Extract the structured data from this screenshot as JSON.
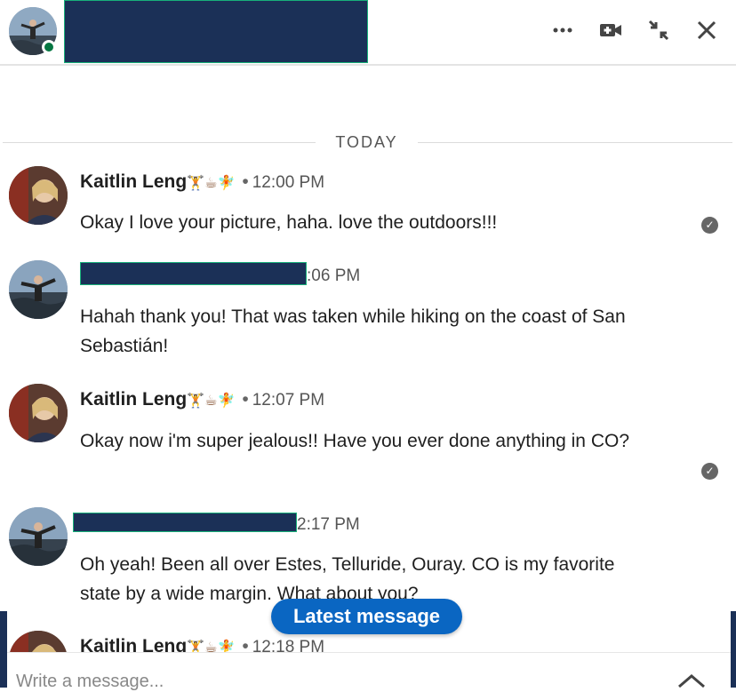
{
  "header": {
    "more_icon": "more-horizontal-icon",
    "video_icon": "video-call-icon",
    "minimize_icon": "minimize-icon",
    "close_icon": "close-icon"
  },
  "divider": {
    "label": "TODAY"
  },
  "messages": [
    {
      "sender": "Kaitlin Leng",
      "emoji": "🏋☕🧚",
      "time": "12:00 PM",
      "text": "Okay I love your picture, haha. love the outdoors!!!",
      "read": true
    },
    {
      "sender": "",
      "time_fragment": ":06 PM",
      "text": "Hahah thank you! That was taken while hiking on the coast of San Sebastián!"
    },
    {
      "sender": "Kaitlin Leng",
      "emoji": "🏋☕🧚",
      "time": "12:07 PM",
      "text": "Okay now i'm super jealous!! Have you ever done anything in CO?",
      "read": true
    },
    {
      "sender": "",
      "time_fragment": "2:17 PM",
      "text": "Oh yeah! Been all over Estes, Telluride, Ouray. CO is my favorite state by a wide margin. What about you?"
    },
    {
      "sender": "Kaitlin Leng",
      "emoji": "🏋☕🧚",
      "time": "12:18 PM"
    }
  ],
  "latest_button": {
    "label": "Latest message"
  },
  "composer": {
    "placeholder": "Write a message..."
  },
  "colors": {
    "accent": "#0a66c2",
    "online": "#057642",
    "redaction": "#1b3057"
  }
}
